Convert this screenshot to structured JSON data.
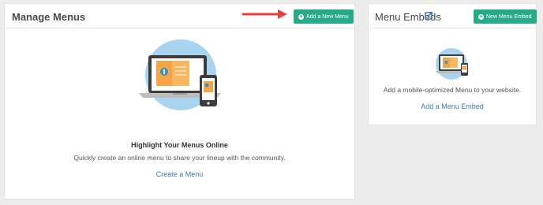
{
  "manage": {
    "title": "Manage Menus",
    "add_button": "Add a New Menu",
    "heading": "Highlight Your Menus Online",
    "description": "Quickly create an online menu to share your lineup with the community.",
    "create_link": "Create a Menu"
  },
  "embeds": {
    "title": "Menu Embeds",
    "add_button": "New Menu Embed",
    "description": "Add a mobile-optimized Menu to your website.",
    "add_link": "Add a Menu Embed"
  },
  "colors": {
    "accent": "#27ab86",
    "link": "#3d7ab8",
    "arrow": "#e0443c"
  }
}
